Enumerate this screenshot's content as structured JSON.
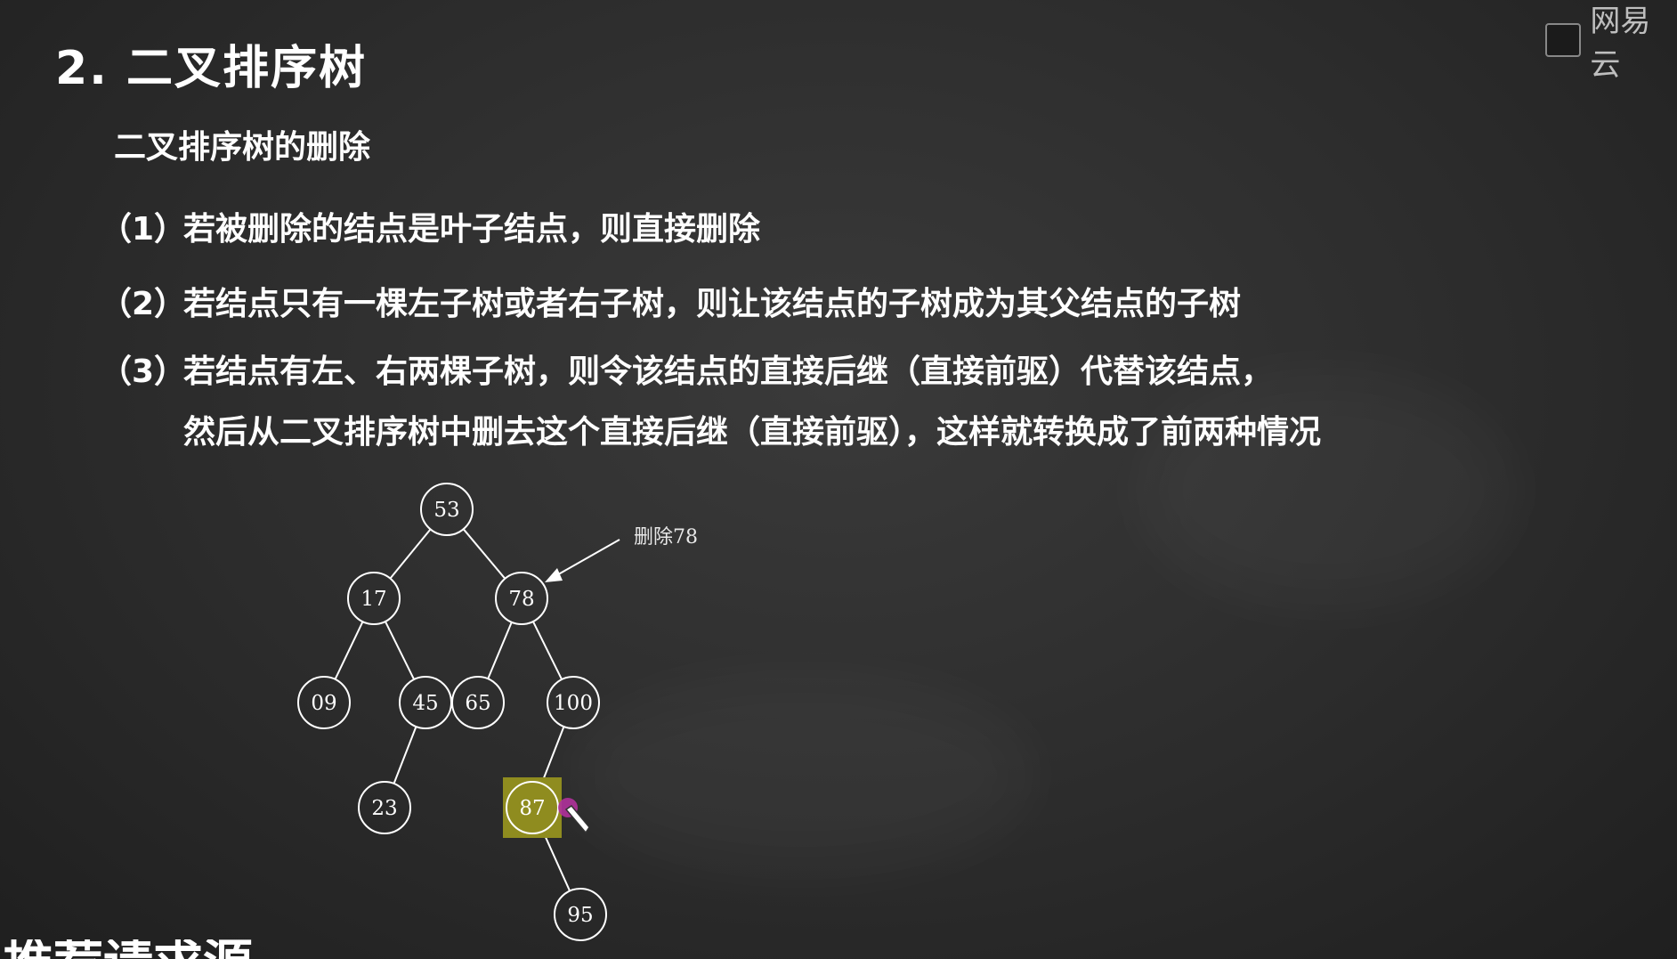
{
  "slide": {
    "title": "2. 二叉排序树",
    "subtitle": "二叉排序树的删除",
    "rules": [
      {
        "num": "（1）",
        "text": "若被删除的结点是叶子结点，则直接删除"
      },
      {
        "num": "（2）",
        "text": "若结点只有一棵左子树或者右子树，则让该结点的子树成为其父结点的子树"
      },
      {
        "num": "（3）",
        "text": "若结点有左、右两棵子树，则令该结点的直接后继（直接前驱）代替该结点，"
      }
    ],
    "rule3_continuation": "然后从二叉排序树中删去这个直接后继（直接前驱），这样就转换成了前两种情况",
    "bottom_partial_text": "推荐请求源"
  },
  "logo": {
    "text": "网易云",
    "icon": "book-icon"
  },
  "tree": {
    "annotation": "删除78",
    "highlighted_node": "87",
    "nodes": [
      {
        "id": "n53",
        "label": "53"
      },
      {
        "id": "n17",
        "label": "17"
      },
      {
        "id": "n78",
        "label": "78"
      },
      {
        "id": "n09",
        "label": "09"
      },
      {
        "id": "n45",
        "label": "45"
      },
      {
        "id": "n65",
        "label": "65"
      },
      {
        "id": "n100",
        "label": "100"
      },
      {
        "id": "n23",
        "label": "23"
      },
      {
        "id": "n87",
        "label": "87"
      },
      {
        "id": "n95",
        "label": "95"
      }
    ],
    "edges": [
      [
        "n53",
        "n17"
      ],
      [
        "n53",
        "n78"
      ],
      [
        "n17",
        "n09"
      ],
      [
        "n17",
        "n45"
      ],
      [
        "n78",
        "n65"
      ],
      [
        "n78",
        "n100"
      ],
      [
        "n45",
        "n23"
      ],
      [
        "n100",
        "n87"
      ],
      [
        "n87",
        "n95"
      ]
    ],
    "colors": {
      "line": "#ffffff",
      "highlight": "#8f8c1f",
      "cursor": "#b0329b"
    }
  }
}
